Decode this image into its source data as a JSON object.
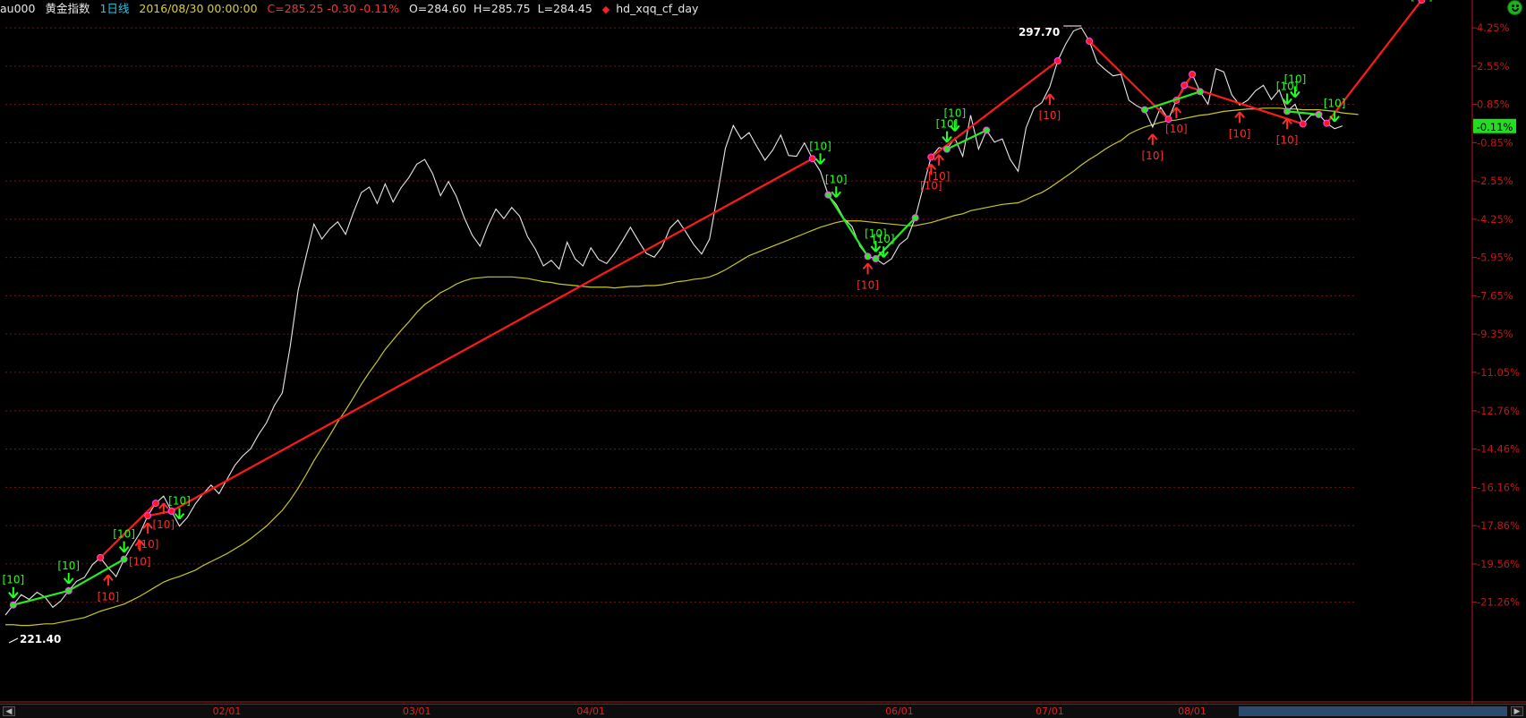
{
  "header": {
    "code": "au000",
    "name": "黄金指数",
    "period": "1日线",
    "date": "2016/08/30 00:00:00",
    "close_info": "C=285.25 -0.30 -0.11%",
    "open": "O=284.60",
    "high": "H=285.75",
    "low": "L=284.45",
    "indicator_name": "hd_xqq_cf_day",
    "indicator_icon": "red-diamond-icon",
    "status_icon": "smiley-icon"
  },
  "colors": {
    "background": "#000000",
    "price_line": "#e8e8e8",
    "ma_line": "#c8c820",
    "up_arrow": "#ff2a2a",
    "down_arrow": "#22ff22",
    "red_segment": "#ff1a1a",
    "green_segment": "#22ee22",
    "axis": "#c01818",
    "grid": "#7a1010",
    "last_badge": "#22dd22"
  },
  "chart_data": {
    "type": "line",
    "ylim": [
      221.4,
      297.7
    ],
    "base_price": 285.55,
    "high_label": "297.70",
    "low_label": "221.40",
    "y_ticks": [
      "4.25%",
      "2.55%",
      "0.85%",
      "-0.85%",
      "-2.55%",
      "-4.25%",
      "-5.95%",
      "-7.65%",
      "-9.35%",
      "-11.05%",
      "-12.76%",
      "-14.46%",
      "-16.16%",
      "-17.86%",
      "-19.56%",
      "-21.26%"
    ],
    "x_ticks": [
      "02/01",
      "03/01",
      "04/01",
      "06/01",
      "07/01",
      "08/01"
    ],
    "x_tick_index": [
      28,
      52,
      74,
      113,
      132,
      150
    ],
    "current_change_label": "-0.11%",
    "close_series": [
      223.2,
      224.5,
      225.8,
      225.2,
      226.1,
      225.5,
      224.2,
      225.0,
      226.3,
      227.5,
      228.0,
      229.6,
      230.5,
      229.2,
      228.1,
      230.3,
      232.0,
      233.6,
      235.8,
      237.4,
      238.3,
      236.4,
      234.5,
      235.6,
      237.3,
      238.6,
      239.7,
      238.6,
      240.4,
      242.2,
      243.4,
      244.3,
      246.1,
      247.6,
      249.8,
      251.4,
      257.3,
      264.4,
      268.7,
      272.8,
      270.9,
      272.2,
      273.1,
      271.5,
      274.3,
      276.8,
      277.5,
      275.4,
      277.9,
      275.6,
      277.4,
      278.7,
      280.4,
      281.0,
      279.2,
      276.4,
      278.2,
      276.3,
      273.6,
      271.4,
      270.0,
      272.6,
      274.7,
      273.5,
      274.9,
      273.8,
      271.2,
      269.6,
      267.5,
      268.2,
      267.1,
      270.5,
      268.4,
      267.5,
      269.8,
      268.3,
      267.8,
      269.1,
      270.7,
      272.4,
      270.7,
      269.1,
      268.6,
      269.9,
      272.3,
      273.3,
      271.8,
      270.2,
      269.0,
      270.9,
      276.5,
      282.4,
      285.3,
      283.6,
      284.4,
      282.6,
      280.9,
      282.2,
      284.1,
      281.5,
      281.4,
      283.1,
      281.1,
      279.5,
      276.5,
      275.3,
      273.5,
      272.5,
      270.0,
      268.7,
      268.4,
      267.7,
      268.4,
      270.2,
      271.0,
      273.6,
      277.5,
      281.3,
      282.5,
      282.3,
      283.7,
      281.4,
      286.6,
      282.3,
      284.7,
      283.2,
      283.6,
      281.0,
      279.5,
      285.0,
      287.5,
      288.2,
      290.2,
      293.5,
      295.6,
      297.3,
      297.7,
      296.0,
      293.3,
      292.4,
      291.6,
      291.8,
      288.5,
      287.8,
      287.3,
      285.1,
      287.6,
      286.1,
      288.5,
      290.4,
      291.8,
      289.6,
      288.0,
      292.5,
      292.1,
      289.2,
      287.9,
      288.5,
      289.7,
      290.4,
      288.6,
      289.8,
      287.1,
      288.0,
      285.5,
      286.6,
      286.7,
      285.6,
      284.9,
      285.25
    ],
    "ma_series": [
      222.0,
      222.0,
      221.9,
      221.9,
      222.0,
      222.1,
      222.1,
      222.3,
      222.5,
      222.7,
      222.9,
      223.3,
      223.7,
      224.0,
      224.3,
      224.6,
      225.1,
      225.6,
      226.2,
      226.8,
      227.4,
      227.8,
      228.1,
      228.5,
      228.9,
      229.5,
      230.0,
      230.5,
      231.0,
      231.6,
      232.2,
      232.9,
      233.7,
      234.5,
      235.5,
      236.5,
      237.8,
      239.3,
      241.0,
      242.8,
      244.4,
      246.0,
      247.7,
      249.2,
      250.8,
      252.5,
      254.0,
      255.4,
      256.9,
      258.1,
      259.3,
      260.4,
      261.6,
      262.6,
      263.3,
      264.1,
      264.6,
      265.2,
      265.6,
      265.9,
      266.0,
      266.1,
      266.1,
      266.1,
      266.1,
      266.0,
      265.9,
      265.7,
      265.5,
      265.4,
      265.2,
      265.1,
      265.0,
      264.9,
      264.8,
      264.8,
      264.8,
      264.7,
      264.8,
      264.9,
      264.9,
      265.0,
      265.0,
      265.1,
      265.3,
      265.5,
      265.6,
      265.8,
      265.9,
      266.1,
      266.5,
      267.0,
      267.6,
      268.2,
      268.8,
      269.2,
      269.6,
      270.0,
      270.4,
      270.8,
      271.2,
      271.6,
      272.0,
      272.4,
      272.7,
      273.0,
      273.2,
      273.2,
      273.2,
      273.1,
      273.0,
      272.9,
      272.8,
      272.7,
      272.6,
      272.6,
      272.8,
      273.0,
      273.3,
      273.6,
      273.9,
      274.1,
      274.5,
      274.7,
      274.9,
      275.1,
      275.3,
      275.4,
      275.5,
      275.9,
      276.4,
      276.8,
      277.4,
      278.1,
      278.8,
      279.5,
      280.3,
      281.0,
      281.6,
      282.3,
      282.9,
      283.4,
      284.2,
      284.7,
      285.1,
      285.4,
      285.7,
      285.9,
      286.0,
      286.2,
      286.4,
      286.6,
      286.7,
      286.9,
      287.1,
      287.2,
      287.3,
      287.4,
      287.4,
      287.5,
      287.5,
      287.5,
      287.4,
      287.4,
      287.3,
      287.3,
      287.3,
      287.2,
      287.1,
      286.9,
      286.8,
      286.7
    ]
  },
  "signals": {
    "tag_text": "[10]",
    "up": [
      13,
      17,
      18,
      20,
      109,
      117,
      118,
      132,
      145,
      148,
      156,
      162
    ],
    "down": [
      1,
      8,
      15,
      22,
      103,
      105,
      110,
      111,
      119,
      120,
      162,
      163,
      168,
      179
    ],
    "segments_red": [
      [
        12,
        19
      ],
      [
        18,
        21
      ],
      [
        21,
        102
      ],
      [
        117,
        133
      ],
      [
        137,
        147
      ],
      [
        148,
        150
      ],
      [
        149,
        164
      ],
      [
        167,
        179
      ]
    ],
    "segments_green": [
      [
        1,
        8
      ],
      [
        8,
        15
      ],
      [
        104,
        109
      ],
      [
        110,
        115
      ],
      [
        119,
        124
      ],
      [
        144,
        151
      ],
      [
        162,
        166
      ]
    ]
  }
}
